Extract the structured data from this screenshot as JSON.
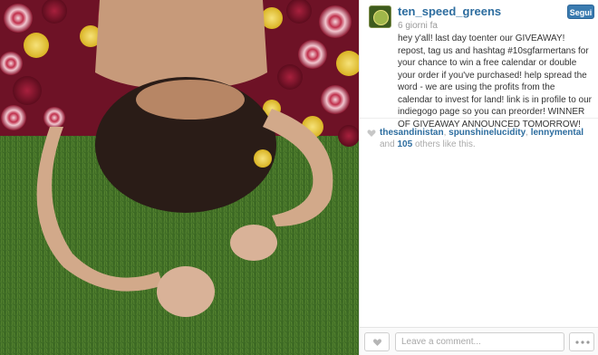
{
  "post": {
    "photo": {
      "description_icon": "photo-woman-lying-on-grass-with-beet-slices"
    },
    "author": {
      "username": "ten_speed_greens",
      "avatar_icon": "ten-speed-greens-logo",
      "follow_label": "Segui"
    },
    "timestamp": "6 giorni fa",
    "caption": "hey y'all! last day toenter our GIVEAWAY! repost, tag us and hashtag #10sgfarmertans for your chance to win a free calendar or double your order if you've purchased! help spread the word - we are using the profits from the calendar to invest for land! link is in profile to our indiegogo page so you can preorder! WINNER OF GIVEAWAY ANNOUNCED TOMORROW!",
    "likes": {
      "likers": [
        "thesandinistan",
        "spunshinelucidity",
        "lennymental"
      ],
      "and_text": "and",
      "count": "105",
      "suffix": "others like this."
    }
  },
  "comment_bar": {
    "placeholder": "Leave a comment...",
    "like_icon": "heart-icon",
    "more_icon": "ellipsis-icon"
  },
  "colors": {
    "link": "#2d6d9f",
    "follow_button": "#3a7bb0"
  }
}
